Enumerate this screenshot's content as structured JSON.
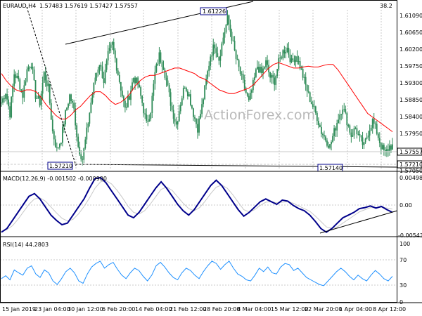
{
  "colors": {
    "candle": "#2e8b57",
    "ma": "#ff0000",
    "macd_line": "#00008b",
    "signal_line": "#c8c8c8",
    "rsi": "#1e90ff",
    "levels_box_border": "#00008b",
    "price_box": "#ffffff",
    "text": "#000000",
    "watermark": "#b0b0b0"
  },
  "header": {
    "instrument": "EURAUD,H4",
    "ohlc": "1.57483 1.57619 1.57427 1.57557"
  },
  "watermark": "ActionForex.com",
  "chart_data": [
    {
      "type": "candlestick",
      "title": "EURAUD,H4 1.57483 1.57619 1.57427 1.57557",
      "y_ticks": [
        "1.61090",
        "1.60650",
        "1.60200",
        "1.59750",
        "1.59300",
        "1.58850",
        "1.58400",
        "1.57950",
        "1.57050"
      ],
      "ylim": [
        1.5695,
        1.6135
      ],
      "corner_value": "38.2",
      "current_price": "1.57557",
      "labels": {
        "high": "1.61226",
        "low_left": "1.57210",
        "low_right": "1.57140",
        "right_level": "1.57210"
      },
      "close_path": [
        1.588,
        1.591,
        1.585,
        1.596,
        1.594,
        1.59,
        1.597,
        1.599,
        1.59,
        1.588,
        1.596,
        1.592,
        1.58,
        1.575,
        1.578,
        1.585,
        1.59,
        1.586,
        1.576,
        1.5725,
        1.58,
        1.588,
        1.595,
        1.599,
        1.594,
        1.601,
        1.604,
        1.598,
        1.592,
        1.586,
        1.59,
        1.595,
        1.593,
        1.588,
        1.582,
        1.586,
        1.596,
        1.601,
        1.598,
        1.592,
        1.586,
        1.582,
        1.588,
        1.593,
        1.59,
        1.585,
        1.581,
        1.587,
        1.594,
        1.601,
        1.604,
        1.6,
        1.606,
        1.611,
        1.606,
        1.6,
        1.596,
        1.592,
        1.588,
        1.593,
        1.598,
        1.596,
        1.599,
        1.595,
        1.594,
        1.599,
        1.602,
        1.603,
        1.599,
        1.601,
        1.598,
        1.594,
        1.59,
        1.587,
        1.584,
        1.58,
        1.578,
        1.576,
        1.58,
        1.584,
        1.587,
        1.583,
        1.579,
        1.581,
        1.578,
        1.576,
        1.58,
        1.583,
        1.58,
        1.576,
        1.574,
        1.576
      ],
      "ma_path": [
        1.596,
        1.594,
        1.5925,
        1.5915,
        1.591,
        1.5915,
        1.5915,
        1.591,
        1.5895,
        1.5875,
        1.586,
        1.5845,
        1.5835,
        1.5835,
        1.5845,
        1.586,
        1.587,
        1.5885,
        1.59,
        1.591,
        1.591,
        1.59,
        1.5885,
        1.5875,
        1.588,
        1.589,
        1.5905,
        1.5925,
        1.594,
        1.595,
        1.5955,
        1.5955,
        1.596,
        1.5965,
        1.597,
        1.5975,
        1.5975,
        1.597,
        1.5965,
        1.596,
        1.595,
        1.5945,
        1.5935,
        1.5925,
        1.5915,
        1.591,
        1.5905,
        1.5905,
        1.591,
        1.5915,
        1.592,
        1.593,
        1.5945,
        1.596,
        1.5975,
        1.5985,
        1.599,
        1.5985,
        1.598,
        1.5975,
        1.5975,
        1.5978,
        1.598,
        1.5978,
        1.5978,
        1.5982,
        1.5985,
        1.5985,
        1.597,
        1.595,
        1.593,
        1.591,
        1.589,
        1.587,
        1.585,
        1.584,
        1.583,
        1.582,
        1.581,
        1.58
      ]
    },
    {
      "type": "line",
      "title": "MACD(12,26,9) -0.001502 -0.000900",
      "y_ticks": [
        "0.004985",
        "0.00",
        "-0.005439"
      ],
      "ylim": [
        -0.0055,
        0.0051
      ],
      "series": [
        {
          "name": "MACD",
          "values": [
            -0.0052,
            -0.0045,
            -0.003,
            -0.0015,
            0.0,
            0.0015,
            0.002,
            0.001,
            -0.0005,
            -0.002,
            -0.003,
            -0.0038,
            -0.0035,
            -0.002,
            -0.0005,
            0.001,
            0.003,
            0.0048,
            0.005,
            0.004,
            0.0025,
            0.001,
            -0.0005,
            -0.002,
            -0.0025,
            -0.0015,
            0.0,
            0.0015,
            0.003,
            0.0042,
            0.003,
            0.0015,
            0.0,
            -0.0012,
            -0.002,
            -0.001,
            0.0005,
            0.002,
            0.0035,
            0.0045,
            0.0035,
            0.002,
            0.0005,
            -0.001,
            -0.0022,
            -0.0015,
            -0.0005,
            0.0005,
            0.001,
            0.0005,
            0.0,
            0.0008,
            0.0006,
            -0.0002,
            -0.0008,
            -0.0012,
            -0.002,
            -0.0032,
            -0.0045,
            -0.0052,
            -0.0045,
            -0.0035,
            -0.0025,
            -0.002,
            -0.0015,
            -0.0008,
            -0.0006,
            -0.0003,
            -0.0007,
            -0.0004,
            -0.001,
            -0.0015
          ]
        },
        {
          "name": "Signal",
          "values": [
            -0.005,
            -0.0047,
            -0.004,
            -0.0028,
            -0.0014,
            0.0,
            0.001,
            0.0012,
            0.0006,
            -0.0005,
            -0.0016,
            -0.0026,
            -0.0031,
            -0.0028,
            -0.0018,
            -0.0004,
            0.0012,
            0.003,
            0.0042,
            0.0044,
            0.0038,
            0.0026,
            0.0012,
            -0.0004,
            -0.0015,
            -0.0018,
            -0.0012,
            0.0,
            0.0014,
            0.0028,
            0.0032,
            0.0026,
            0.0014,
            0.0002,
            -0.0008,
            -0.0012,
            -0.0006,
            0.0006,
            0.002,
            0.0032,
            0.0036,
            0.003,
            0.0018,
            0.0004,
            -0.001,
            -0.0014,
            -0.001,
            -0.0002,
            0.0004,
            0.0005,
            0.0003,
            0.0004,
            0.0005,
            0.0002,
            -0.0003,
            -0.0008,
            -0.0013,
            -0.0022,
            -0.0032,
            -0.0042,
            -0.0045,
            -0.0042,
            -0.0035,
            -0.0028,
            -0.0021,
            -0.0014,
            -0.001,
            -0.0006,
            -0.0006,
            -0.0005,
            -0.0007,
            -0.0009
          ]
        }
      ]
    },
    {
      "type": "line",
      "title": "RSI(14) 44.2803",
      "y_ticks": [
        "100",
        "70",
        "30",
        "0"
      ],
      "ylim": [
        0,
        100
      ],
      "series": [
        {
          "name": "RSI",
          "values": [
            40,
            45,
            38,
            55,
            50,
            46,
            58,
            62,
            48,
            42,
            55,
            50,
            36,
            30,
            40,
            52,
            58,
            50,
            36,
            32,
            48,
            60,
            66,
            70,
            58,
            64,
            68,
            56,
            46,
            40,
            50,
            58,
            54,
            44,
            36,
            46,
            62,
            68,
            60,
            50,
            42,
            38,
            50,
            58,
            54,
            46,
            40,
            52,
            62,
            70,
            66,
            56,
            64,
            70,
            58,
            48,
            44,
            38,
            36,
            46,
            58,
            52,
            60,
            50,
            48,
            60,
            66,
            64,
            54,
            58,
            50,
            42,
            38,
            34,
            30,
            28,
            36,
            44,
            52,
            58,
            52,
            44,
            38,
            46,
            40,
            36,
            46,
            54,
            48,
            40,
            36,
            44
          ]
        }
      ]
    }
  ],
  "x_axis": {
    "labels": [
      "15 Jan 2019",
      "23 Jan 04:00",
      "30 Jan 12:00",
      "6 Feb 20:00",
      "14 Feb 04:00",
      "21 Feb 12:00",
      "28 Feb 20:00",
      "8 Mar 04:00",
      "15 Mar 12:00",
      "22 Mar 20:00",
      "1 Apr 04:00",
      "8 Apr 12:00"
    ]
  }
}
